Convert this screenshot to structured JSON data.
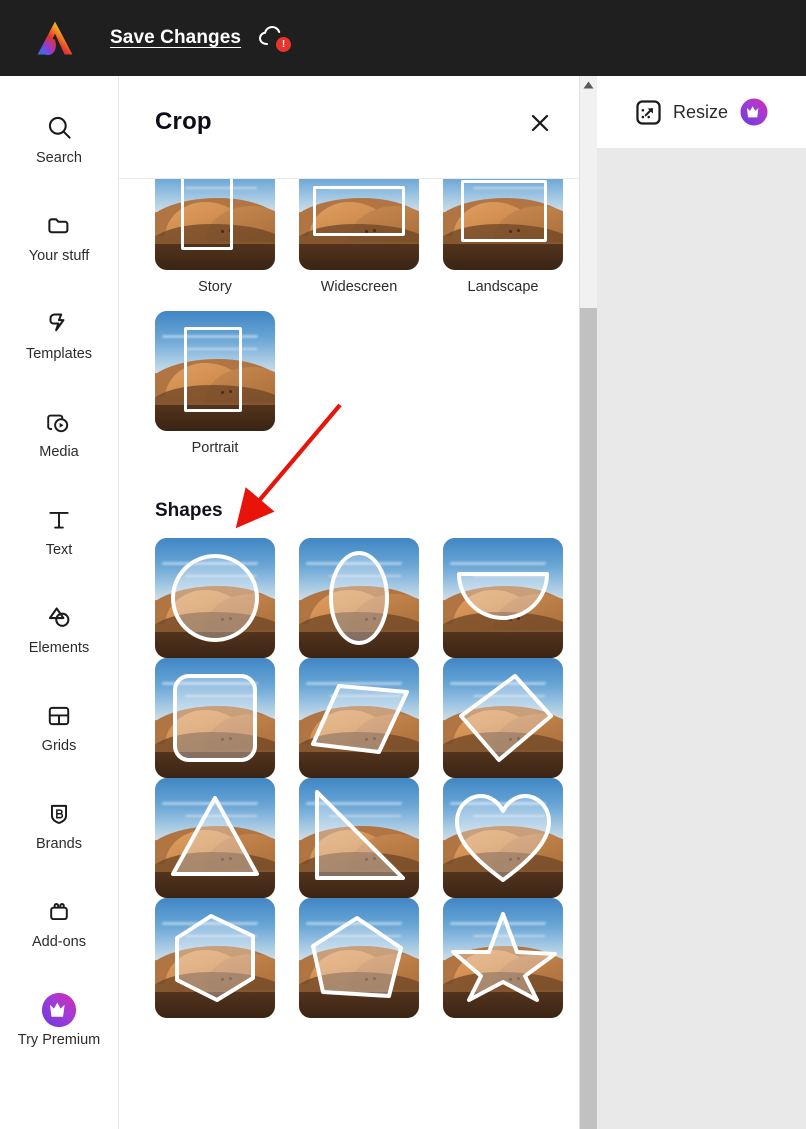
{
  "app": {
    "logo_icon": "adobe-express-logo",
    "theme_dark_bg": "#1f1f1f"
  },
  "topbar": {
    "save_label": "Save Changes",
    "cloud_icon": "cloud-error-icon",
    "cloud_badge": "!",
    "badge_color": "#e8342a"
  },
  "sidebar": {
    "items": [
      {
        "label": "Search",
        "icon": "search-icon"
      },
      {
        "label": "Your stuff",
        "icon": "folder-icon"
      },
      {
        "label": "Templates",
        "icon": "templates-icon"
      },
      {
        "label": "Media",
        "icon": "media-play-icon"
      },
      {
        "label": "Text",
        "icon": "text-t-icon"
      },
      {
        "label": "Elements",
        "icon": "elements-shapes-icon"
      },
      {
        "label": "Grids",
        "icon": "grids-icon"
      },
      {
        "label": "Brands",
        "icon": "brand-shield-b-icon"
      },
      {
        "label": "Add-ons",
        "icon": "add-ons-icon"
      },
      {
        "label": "Try Premium",
        "icon": "premium-crown-icon"
      }
    ]
  },
  "panel": {
    "title": "Crop",
    "close_icon": "close-icon",
    "aspect_ratios": [
      {
        "label": "Story",
        "shape": "rect-portrait"
      },
      {
        "label": "Widescreen",
        "shape": "rect-wide"
      },
      {
        "label": "Landscape",
        "shape": "rect-landscape"
      },
      {
        "label": "Portrait",
        "shape": "rect-tall"
      }
    ],
    "shapes_heading": "Shapes",
    "shapes": [
      {
        "name": "circle"
      },
      {
        "name": "ellipse"
      },
      {
        "name": "half-circle"
      },
      {
        "name": "rounded-square"
      },
      {
        "name": "parallelogram"
      },
      {
        "name": "diamond"
      },
      {
        "name": "triangle"
      },
      {
        "name": "right-triangle"
      },
      {
        "name": "heart"
      },
      {
        "name": "hexagon"
      },
      {
        "name": "pentagon"
      },
      {
        "name": "star"
      }
    ]
  },
  "scrollbar": {
    "up_arrow_icon": "caret-up-icon"
  },
  "toolbar_right": {
    "resize_label": "Resize",
    "resize_icon": "resize-expand-icon",
    "premium_icon": "premium-crown-icon"
  },
  "annotation": {
    "arrow_color": "#e8140a",
    "arrow_from": "340,405",
    "arrow_to": "243,519",
    "points_at": "shape-circle"
  }
}
